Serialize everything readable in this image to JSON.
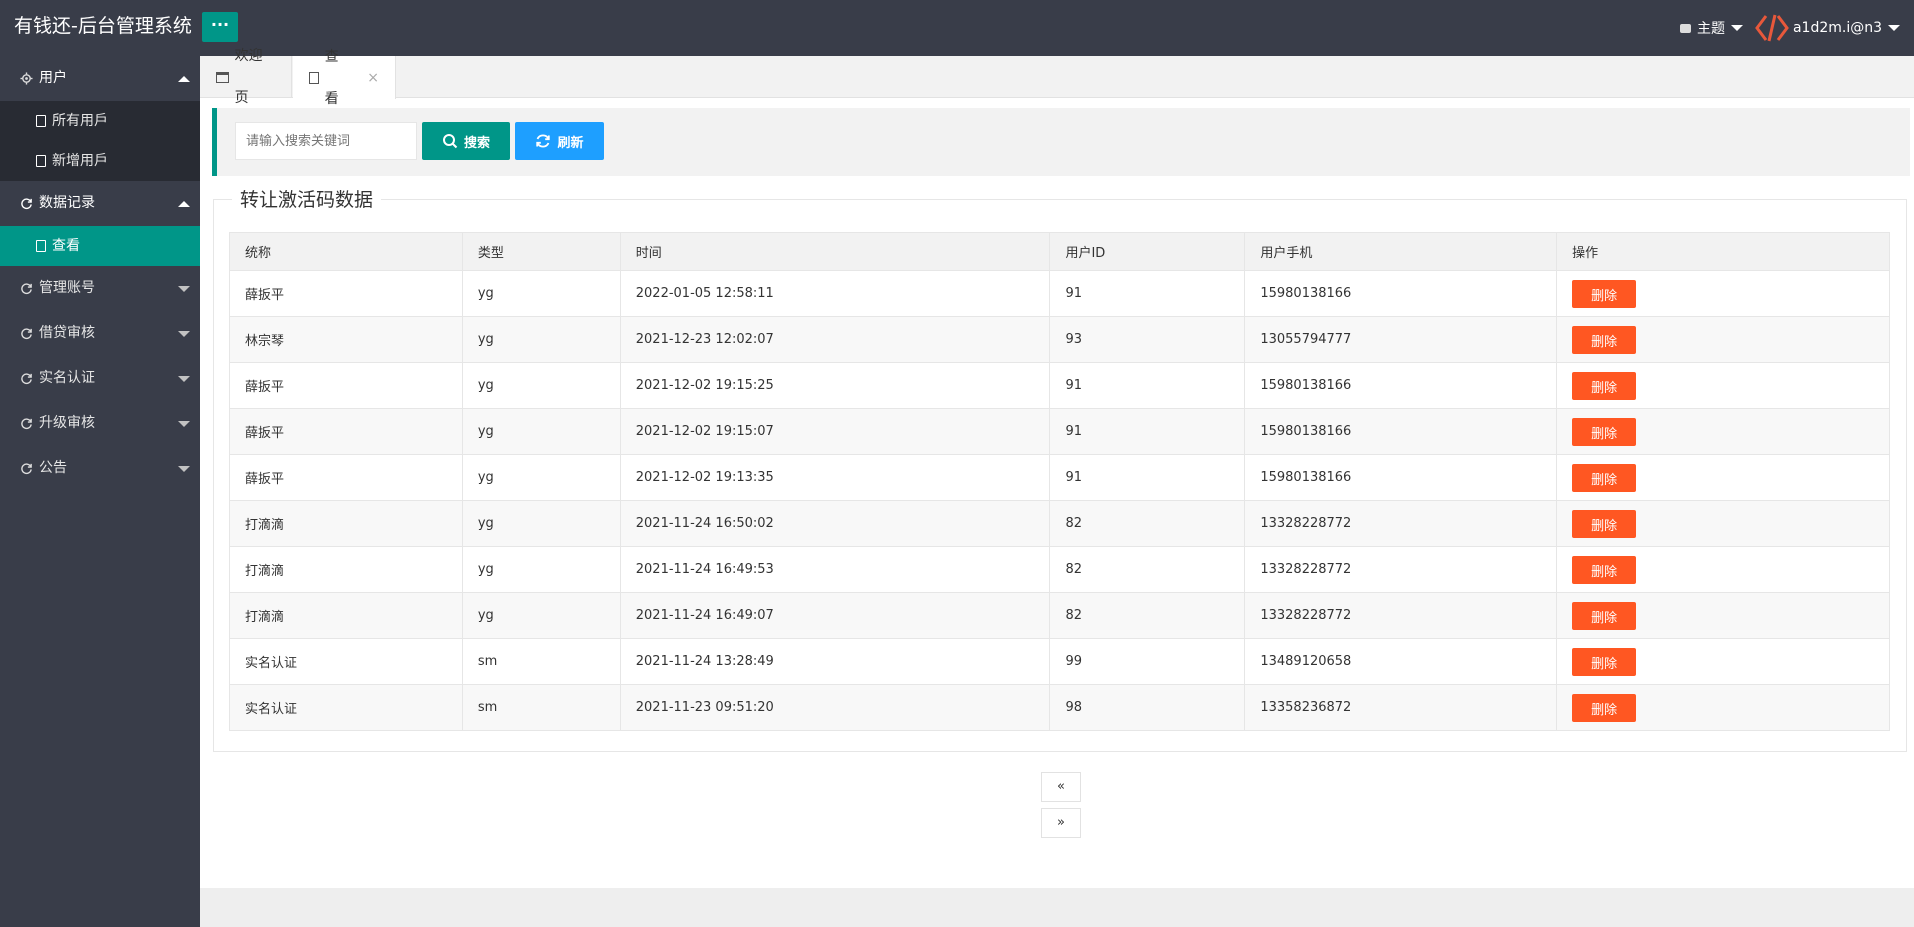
{
  "header": {
    "title": "有钱还-后台管理系统",
    "menu_toggle": "···",
    "theme_label": "主题",
    "username": "a1d2m.i@n3"
  },
  "sidebar": {
    "groups": [
      {
        "label": "用户",
        "expanded": true,
        "items": [
          {
            "label": "所有用戶"
          },
          {
            "label": "新增用戶"
          }
        ]
      },
      {
        "label": "数据记录",
        "expanded": true,
        "items": [
          {
            "label": "查看",
            "active": true
          }
        ]
      },
      {
        "label": "管理账号",
        "expanded": false
      },
      {
        "label": "借贷审核",
        "expanded": false
      },
      {
        "label": "实名认证",
        "expanded": false
      },
      {
        "label": "升级审核",
        "expanded": false
      },
      {
        "label": "公告",
        "expanded": false
      }
    ]
  },
  "tabs": [
    {
      "label": "欢迎页"
    },
    {
      "label": "查看",
      "close": "×"
    }
  ],
  "toolbar": {
    "search_placeholder": "请输入搜索关键词",
    "search_label": "搜索",
    "refresh_label": "刷新"
  },
  "panel": {
    "legend": "转让激活码数据"
  },
  "table": {
    "headers": [
      "统称",
      "类型",
      "时间",
      "用户ID",
      "用户手机",
      "操作"
    ],
    "delete_label": "删除",
    "rows": [
      [
        "薛扳平",
        "yg",
        "2022-01-05 12:58:11",
        "91",
        "15980138166"
      ],
      [
        "林宗琴",
        "yg",
        "2021-12-23 12:02:07",
        "93",
        "13055794777"
      ],
      [
        "薛扳平",
        "yg",
        "2021-12-02 19:15:25",
        "91",
        "15980138166"
      ],
      [
        "薛扳平",
        "yg",
        "2021-12-02 19:15:07",
        "91",
        "15980138166"
      ],
      [
        "薛扳平",
        "yg",
        "2021-12-02 19:13:35",
        "91",
        "15980138166"
      ],
      [
        "打滴滴",
        "yg",
        "2021-11-24 16:50:02",
        "82",
        "13328228772"
      ],
      [
        "打滴滴",
        "yg",
        "2021-11-24 16:49:53",
        "82",
        "13328228772"
      ],
      [
        "打滴滴",
        "yg",
        "2021-11-24 16:49:07",
        "82",
        "13328228772"
      ],
      [
        "实名认证",
        "sm",
        "2021-11-24 13:28:49",
        "99",
        "13489120658"
      ],
      [
        "实名认证",
        "sm",
        "2021-11-23 09:51:20",
        "98",
        "13358236872"
      ]
    ]
  },
  "pager": {
    "prev": "«",
    "next": "»"
  },
  "colors": {
    "header_bg": "#393d49",
    "accent": "#009688",
    "refresh": "#1e9fff",
    "delete": "#ff5722"
  }
}
